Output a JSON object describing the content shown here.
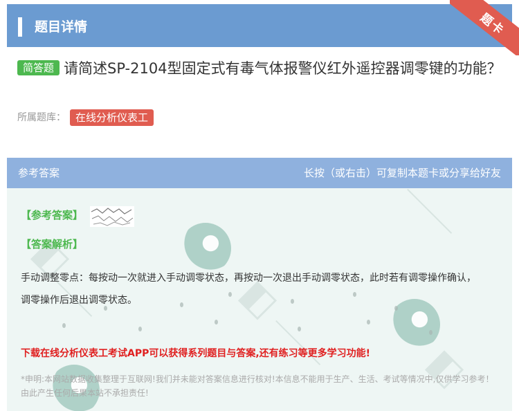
{
  "header": {
    "title": "题目详情",
    "ribbon_label": "题卡"
  },
  "question": {
    "type_tag": "简答题",
    "text": "请简述SP-2104型固定式有毒气体报警仪红外遥控器调零键的功能？"
  },
  "bank": {
    "label": "所属题库：",
    "name": "在线分析仪表工"
  },
  "answer_panel": {
    "label": "参考答案",
    "hint": "长按（或右击）可复制本题卡或分享给好友",
    "reference_label": "【参考答案】",
    "analysis_label": "【答案解析】",
    "analysis_text": "手动调整零点：每按动一次就进入手动调零状态，再按动一次退出手动调零状态，此时若有调零操作确认，调零操作后退出调零状态。",
    "promo": "下载在线分析仪表工考试APP可以获得系列题目与答案,还有练习等更多学习功能!",
    "disclaimer": "*申明:本网站数据收集整理于互联网!我们并未能对答案信息进行核对!本信息不能用于生产、生活、考试等情况中,仅供学习参考！由此产生任何后果本站不承担责任!"
  },
  "colors": {
    "header": "#6b9bd1",
    "answer_bar": "#8fb1de",
    "green_tag": "#4db84f",
    "red_tag": "#e05c50",
    "promo": "#e02020"
  }
}
